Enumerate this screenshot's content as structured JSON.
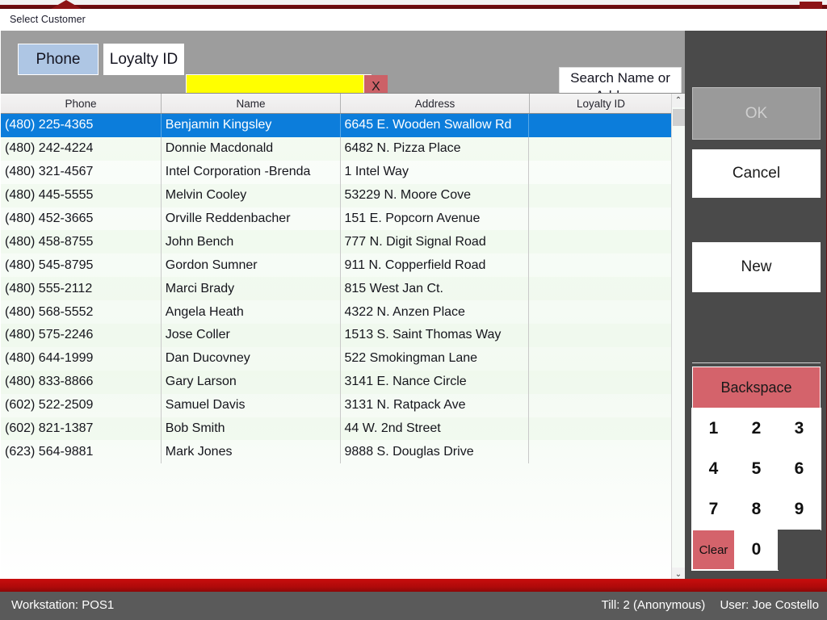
{
  "window": {
    "title": "Select Customer"
  },
  "toolbar": {
    "tab_phone": "Phone",
    "tab_loyalty": "Loyalty ID",
    "search_value": "",
    "search_placeholder": "",
    "clear_button": "X",
    "search_name_or_address": "Search Name or Address"
  },
  "grid": {
    "columns": [
      "Phone",
      "Name",
      "Address",
      "Loyalty ID"
    ],
    "selected_index": 0,
    "rows": [
      {
        "phone": "(480) 225-4365",
        "name": "Benjamin Kingsley",
        "address": "6645 E. Wooden Swallow Rd",
        "loyalty": ""
      },
      {
        "phone": "(480) 242-4224",
        "name": "Donnie Macdonald",
        "address": "6482 N. Pizza Place",
        "loyalty": ""
      },
      {
        "phone": "(480) 321-4567",
        "name": "Intel Corporation -Brenda",
        "address": "1 Intel Way",
        "loyalty": ""
      },
      {
        "phone": "(480) 445-5555",
        "name": "Melvin Cooley",
        "address": "53229 N. Moore Cove",
        "loyalty": ""
      },
      {
        "phone": "(480) 452-3665",
        "name": "Orville Reddenbacher",
        "address": "151 E. Popcorn Avenue",
        "loyalty": ""
      },
      {
        "phone": "(480) 458-8755",
        "name": "John Bench",
        "address": "777 N. Digit Signal Road",
        "loyalty": ""
      },
      {
        "phone": "(480) 545-8795",
        "name": "Gordon Sumner",
        "address": "911 N. Copperfield Road",
        "loyalty": ""
      },
      {
        "phone": "(480) 555-2112",
        "name": "Marci Brady",
        "address": "815 West Jan Ct.",
        "loyalty": ""
      },
      {
        "phone": "(480) 568-5552",
        "name": "Angela Heath",
        "address": "4322 N. Anzen Place",
        "loyalty": ""
      },
      {
        "phone": "(480) 575-2246",
        "name": "Jose Coller",
        "address": "1513 S. Saint Thomas Way",
        "loyalty": ""
      },
      {
        "phone": "(480) 644-1999",
        "name": "Dan Ducovney",
        "address": "522 Smokingman Lane",
        "loyalty": ""
      },
      {
        "phone": "(480) 833-8866",
        "name": "Gary Larson",
        "address": "3141 E. Nance Circle",
        "loyalty": ""
      },
      {
        "phone": "(602) 522-2509",
        "name": "Samuel Davis",
        "address": "3131 N. Ratpack Ave",
        "loyalty": ""
      },
      {
        "phone": "(602) 821-1387",
        "name": "Bob Smith",
        "address": "44 W. 2nd Street",
        "loyalty": ""
      },
      {
        "phone": "(623) 564-9881",
        "name": "Mark Jones",
        "address": "9888 S. Douglas Drive",
        "loyalty": ""
      }
    ]
  },
  "scrollbar": {
    "up_arrow": "⌃",
    "down_arrow": "⌄"
  },
  "actions": {
    "ok": "OK",
    "cancel": "Cancel",
    "new": "New"
  },
  "keypad": {
    "backspace": "Backspace",
    "keys": [
      "1",
      "2",
      "3",
      "4",
      "5",
      "6",
      "7",
      "8",
      "9"
    ],
    "clear": "Clear",
    "zero": "0"
  },
  "statusbar": {
    "workstation": "Workstation: POS1",
    "till": "Till: 2 (Anonymous)",
    "user": "User: Joe Costello"
  },
  "colors": {
    "selection_blue": "#0c7ddb",
    "search_yellow": "#ffff00",
    "tab_active_blue": "#aec6e4",
    "key_red": "#d4636b",
    "status_red": "#c80d0d",
    "panel_dark": "#4a4a4a"
  }
}
